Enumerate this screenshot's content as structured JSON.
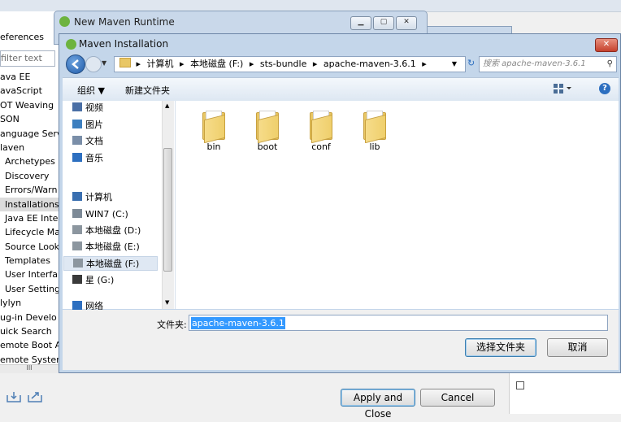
{
  "background": {
    "left_panel": {
      "header": "eferences",
      "filter_placeholder": "filter text",
      "tree": [
        {
          "label": "ava EE",
          "sub": false,
          "selected": false
        },
        {
          "label": "avaScript",
          "sub": false,
          "selected": false
        },
        {
          "label": "OT Weaving",
          "sub": false,
          "selected": false
        },
        {
          "label": "SON",
          "sub": false,
          "selected": false
        },
        {
          "label": "anguage Serv",
          "sub": false,
          "selected": false
        },
        {
          "label": "laven",
          "sub": false,
          "selected": false
        },
        {
          "label": "Archetypes",
          "sub": true,
          "selected": false
        },
        {
          "label": "Discovery",
          "sub": true,
          "selected": false
        },
        {
          "label": "Errors/Warn",
          "sub": true,
          "selected": false
        },
        {
          "label": "Installations",
          "sub": true,
          "selected": true
        },
        {
          "label": "Java EE Inte",
          "sub": true,
          "selected": false
        },
        {
          "label": "Lifecycle Ma",
          "sub": true,
          "selected": false
        },
        {
          "label": "Source Look",
          "sub": true,
          "selected": false
        },
        {
          "label": "Templates",
          "sub": true,
          "selected": false
        },
        {
          "label": "User Interfa",
          "sub": true,
          "selected": false
        },
        {
          "label": "User Setting",
          "sub": true,
          "selected": false
        },
        {
          "label": "lylyn",
          "sub": false,
          "selected": false
        },
        {
          "label": "ug-in Develo",
          "sub": false,
          "selected": false
        },
        {
          "label": "uick Search",
          "sub": false,
          "selected": false
        },
        {
          "label": "emote Boot Ap",
          "sub": false,
          "selected": false
        },
        {
          "label": "emote Systems",
          "sub": false,
          "selected": false
        }
      ],
      "scroll_grip": "III"
    },
    "new_runtime_title": "New Maven Runtime",
    "apply_close": "Apply and Close",
    "cancel": "Cancel"
  },
  "dialog": {
    "title": "Maven Installation",
    "close_glyph": "✕",
    "breadcrumb": [
      "计算机",
      "本地磁盘 (F:)",
      "sts-bundle",
      "apache-maven-3.6.1"
    ],
    "search_placeholder": "搜索 apache-maven-3.6.1",
    "toolbar": {
      "organize": "组织 ▼",
      "new_folder": "新建文件夹"
    },
    "nav_items": [
      {
        "label": "视频",
        "icon": "video-icon",
        "color": "#4a6fa5"
      },
      {
        "label": "图片",
        "icon": "picture-icon",
        "color": "#3d7fbf"
      },
      {
        "label": "文档",
        "icon": "document-icon",
        "color": "#7a8ea8"
      },
      {
        "label": "音乐",
        "icon": "music-icon",
        "color": "#2d6fc0"
      },
      {
        "label": "计算机",
        "icon": "computer-icon",
        "color": "#3a6fb0"
      },
      {
        "label": "WIN7 (C:)",
        "icon": "windows-drive-icon",
        "color": "#7d8a97"
      },
      {
        "label": "本地磁盘 (D:)",
        "icon": "drive-icon",
        "color": "#8c969f"
      },
      {
        "label": "本地磁盘 (E:)",
        "icon": "drive-icon",
        "color": "#8c969f"
      },
      {
        "label": "本地磁盘 (F:)",
        "icon": "drive-icon",
        "color": "#8c969f"
      },
      {
        "label": "星 (G:)",
        "icon": "drive-icon",
        "color": "#3a3a3a"
      },
      {
        "label": "网络",
        "icon": "network-icon",
        "color": "#2d6fc0"
      }
    ],
    "selected_nav": "本地磁盘 (F:)",
    "folders": [
      "bin",
      "boot",
      "conf",
      "lib"
    ],
    "folder_label": "文件夹:",
    "folder_value": "apache-maven-3.6.1",
    "select_button": "选择文件夹",
    "cancel_button": "取消"
  },
  "colors": {
    "selection": "#3399ff",
    "title_bar": "#c4d6ea",
    "close_red": "#c5412d",
    "folder_yellow": "#efcf6c"
  }
}
